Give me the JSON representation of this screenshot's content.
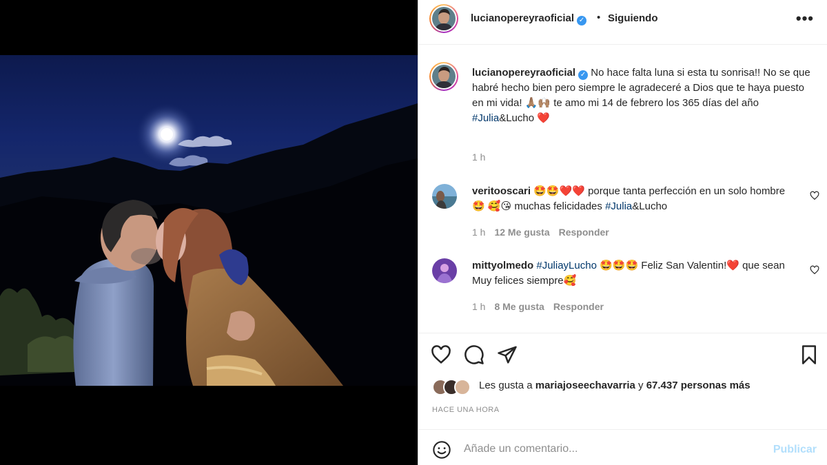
{
  "post": {
    "author": "lucianopereyraoficial",
    "follow_dot": "•",
    "follow_status": "Siguiendo",
    "more_icon": "more-horizontal-icon",
    "verified_icon": "verified-check-icon"
  },
  "caption": {
    "author": "lucianopereyraoficial",
    "text_part1": " No hace falta luna si esta tu sonrisa!! No se que habré hecho bien pero siempre le agradeceré a Dios que te haya puesto en mi vida! 🙏🏽🙌🏽 te amo mi 14 de febrero los 365 días del año",
    "hashtag": "#Julia",
    "hashtag_tail": "&Lucho",
    "emoji_tail": " ❤️",
    "time": "1 h"
  },
  "comments": [
    {
      "author": "veritooscari",
      "text_pre": " 🤩🤩❤️❤️ porque tanta perfección en un solo hombre 🤩 🥰😘 muchas felicidades ",
      "tag": "#Julia",
      "text_post": "&Lucho",
      "time": "1 h",
      "likes": "12 Me gusta",
      "reply": "Responder"
    },
    {
      "author": "mittyolmedo",
      "text_pre": " ",
      "tag": "#JuliayLucho",
      "text_post": " 🤩🤩🤩 Feliz San Valentin!❤️ que sean Muy felices siempre🥰",
      "time": "1 h",
      "likes": "8 Me gusta",
      "reply": "Responder"
    }
  ],
  "actions": {
    "like_icon": "heart-icon",
    "comment_icon": "comment-icon",
    "share_icon": "paper-plane-icon",
    "save_icon": "bookmark-icon"
  },
  "likes": {
    "prefix": "Les gusta a ",
    "user": "mariajoseechavarria",
    "middle": " y ",
    "count": "67.437 personas más"
  },
  "posted_time": "HACE UNA HORA",
  "add_comment": {
    "placeholder": "Añade un comentario...",
    "publish": "Publicar",
    "emoji_icon": "smiley-icon"
  },
  "colors": {
    "link": "#00376b",
    "verified": "#3897f0",
    "muted": "#8e8e8e",
    "publish_disabled": "#b2dffc"
  }
}
